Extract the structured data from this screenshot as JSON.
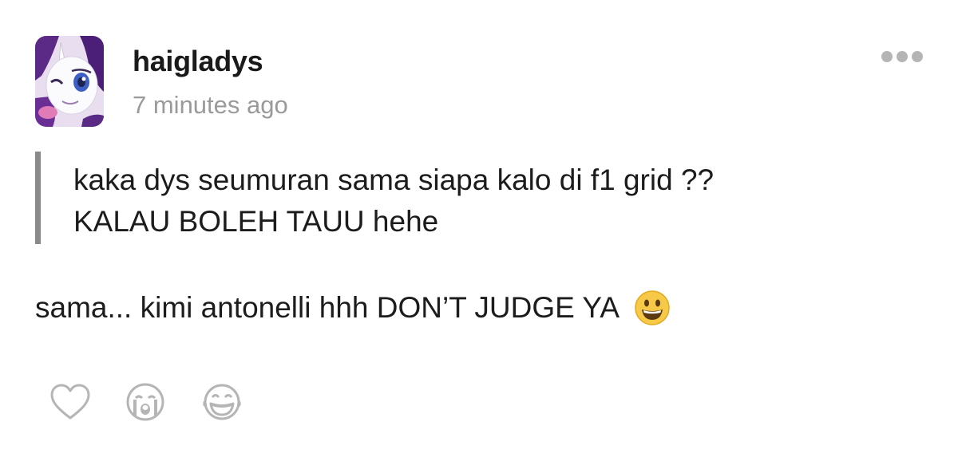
{
  "post": {
    "username": "haigladys",
    "timestamp": "7 minutes ago",
    "avatar_icon": "rarity-pony-avatar-icon",
    "more_icon": "more-options-icon"
  },
  "question": {
    "line1": "kaka dys seumuran sama siapa kalo di f1 grid ??",
    "line2": "KALAU BOLEH TAUU hehe"
  },
  "answer": {
    "text": "sama... kimi antonelli hhh DON’T JUDGE YA",
    "emoji": "grinning-face-emoji"
  },
  "reactions": [
    {
      "name": "heart-icon"
    },
    {
      "name": "crying-face-icon"
    },
    {
      "name": "laughing-tears-icon"
    }
  ],
  "colors": {
    "text": "#1c1c1c",
    "muted": "#9a9a9a",
    "quote_bar": "#8a8a8a",
    "icon_gray": "#b5b5b5",
    "emoji_yellow": "#f7c948"
  }
}
